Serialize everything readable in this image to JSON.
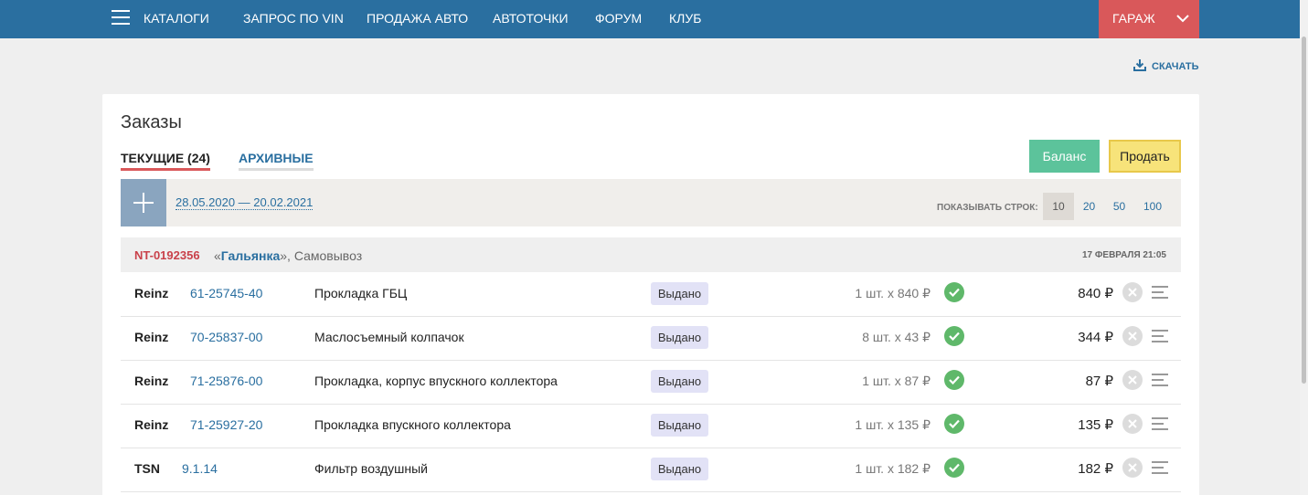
{
  "nav": {
    "catalogs": "КАТАЛОГИ",
    "vin": "ЗАПРОС ПО VIN",
    "sale": "ПРОДАЖА АВТО",
    "points": "АВТОТОЧКИ",
    "forum": "ФОРУМ",
    "club": "КЛУБ",
    "garage": "ГАРАЖ"
  },
  "download": "СКАЧАТЬ",
  "page_title": "Заказы",
  "tabs": {
    "current": "ТЕКУЩИЕ (24)",
    "archive": "АРХИВНЫЕ"
  },
  "buttons": {
    "balance": "Баланс",
    "sell": "Продать"
  },
  "filter": {
    "date_range": "28.05.2020 — 20.02.2021",
    "show_rows_label": "ПОКАЗЫВАТЬ СТРОК:",
    "page_sizes": [
      "10",
      "20",
      "50",
      "100"
    ],
    "active_page_size": "10"
  },
  "order": {
    "id": "NT-0192356",
    "store_prefix": "«",
    "store": "Гальянка",
    "store_suffix": "», Самовывоз",
    "date": "17 ФЕВРАЛЯ 21:05"
  },
  "items": [
    {
      "brand": "Reinz",
      "part": "61-25745-40",
      "name": "Прокладка ГБЦ",
      "status": "Выдано",
      "qty": "1 шт. х 840 ₽",
      "total": "840 ₽"
    },
    {
      "brand": "Reinz",
      "part": "70-25837-00",
      "name": "Маслосъемный колпачок",
      "status": "Выдано",
      "qty": "8 шт. х 43 ₽",
      "total": "344 ₽"
    },
    {
      "brand": "Reinz",
      "part": "71-25876-00",
      "name": "Прокладка, корпус впускного коллектора",
      "status": "Выдано",
      "qty": "1 шт. х 87 ₽",
      "total": "87 ₽"
    },
    {
      "brand": "Reinz",
      "part": "71-25927-20",
      "name": "Прокладка впускного коллектора",
      "status": "Выдано",
      "qty": "1 шт. х 135 ₽",
      "total": "135 ₽"
    },
    {
      "brand": "TSN",
      "part": "9.1.14",
      "name": "Фильтр воздушный",
      "status": "Выдано",
      "qty": "1 шт. х 182 ₽",
      "total": "182 ₽"
    }
  ],
  "colors": {
    "nav_bg": "#2a6fa0",
    "garage_bg": "#d9585a",
    "balance_bg": "#5cc39b",
    "sell_bg": "#f7e37a",
    "status_bg": "#e2e2f6",
    "check_green": "#5fb86a"
  }
}
